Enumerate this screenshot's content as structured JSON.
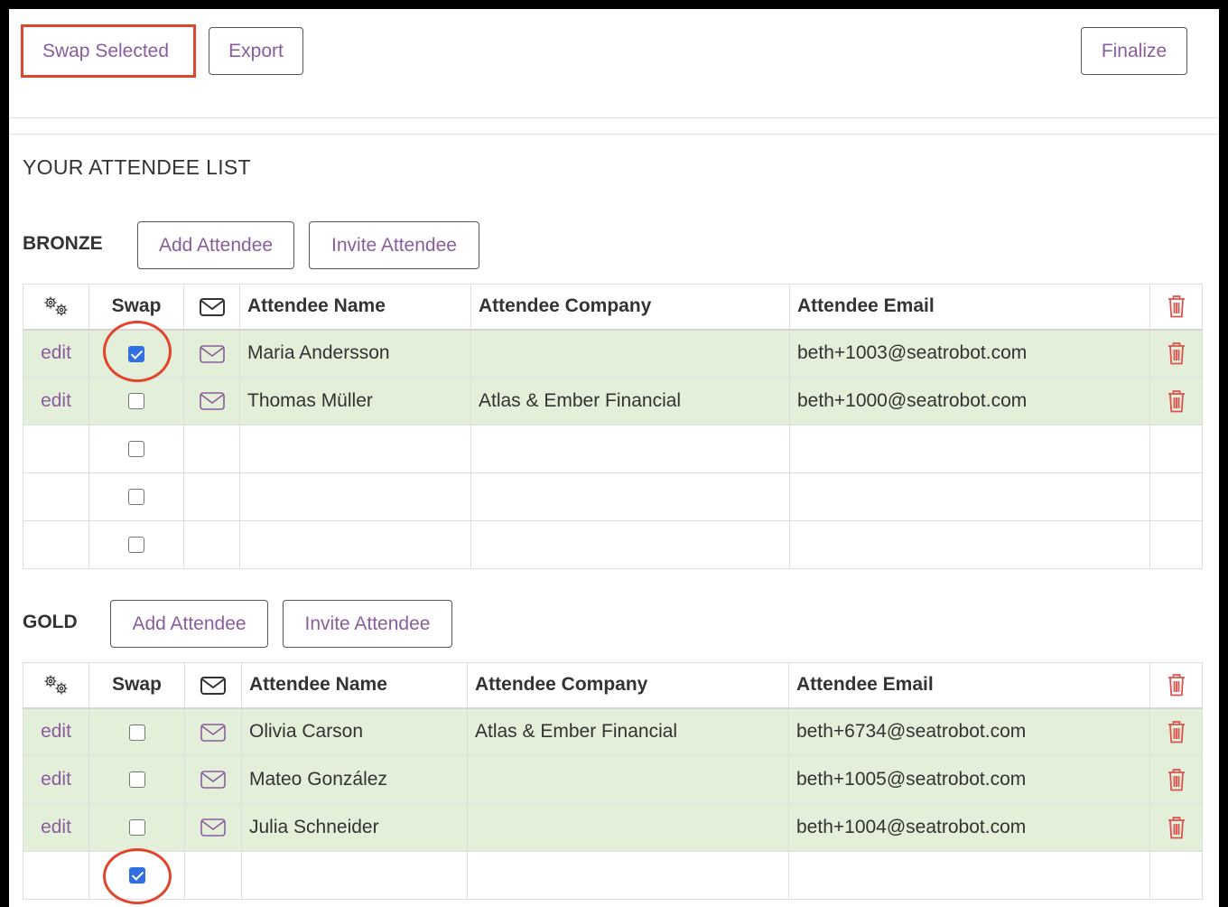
{
  "toolbar": {
    "swap_selected_label": "Swap Selected",
    "export_label": "Export",
    "finalize_label": "Finalize"
  },
  "page": {
    "section_title": "YOUR ATTENDEE LIST"
  },
  "columns": {
    "swap": "Swap",
    "name": "Attendee Name",
    "company": "Attendee Company",
    "email": "Attendee Email"
  },
  "groups": [
    {
      "label": "BRONZE",
      "add_label": "Add Attendee",
      "invite_label": "Invite Attendee",
      "rows": [
        {
          "edit": "edit",
          "checked": true,
          "name": "Maria Andersson",
          "company": "",
          "email": "beth+1003@seatrobot.com"
        },
        {
          "edit": "edit",
          "checked": false,
          "name": "Thomas Müller",
          "company": "Atlas & Ember Financial",
          "email": "beth+1000@seatrobot.com"
        }
      ],
      "empty_rows": 3
    },
    {
      "label": "GOLD",
      "add_label": "Add Attendee",
      "invite_label": "Invite Attendee",
      "rows": [
        {
          "edit": "edit",
          "checked": false,
          "name": "Olivia Carson",
          "company": "Atlas & Ember Financial",
          "email": "beth+6734@seatrobot.com"
        },
        {
          "edit": "edit",
          "checked": false,
          "name": "Mateo González",
          "company": "",
          "email": "beth+1005@seatrobot.com"
        },
        {
          "edit": "edit",
          "checked": false,
          "name": "Julia Schneider",
          "company": "",
          "email": "beth+1004@seatrobot.com"
        }
      ],
      "empty_rows_checked": [
        true
      ]
    }
  ],
  "colors": {
    "accent": "#8a5c9e",
    "highlight": "#e0452d",
    "filled_row": "#e3efd8",
    "trash": "#d9534f",
    "checkbox_checked": "#2f6fe0"
  },
  "icons": {
    "settings": "gears-icon",
    "mail": "envelope-icon",
    "delete": "trash-icon"
  }
}
